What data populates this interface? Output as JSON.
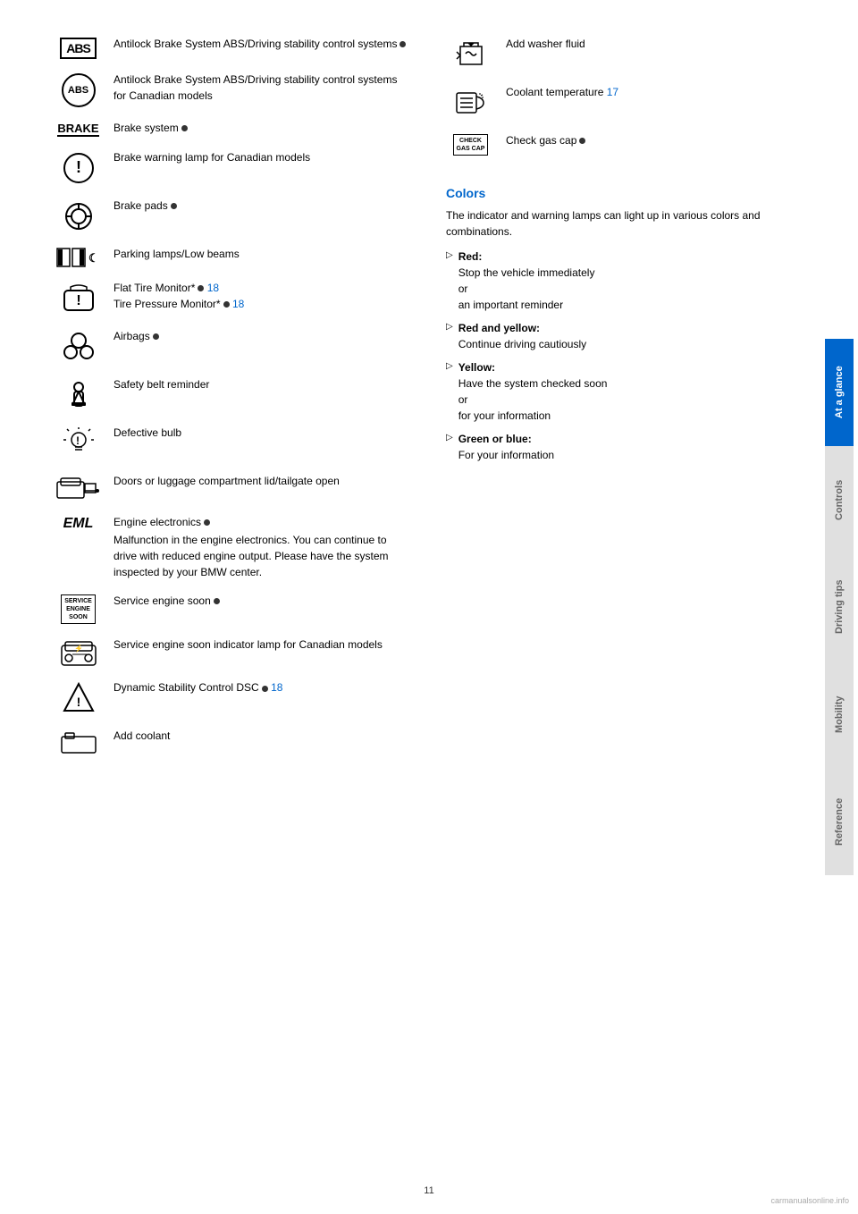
{
  "page": {
    "number": "11",
    "watermark": "carmanualsonline.info"
  },
  "sidebar": {
    "tabs": [
      {
        "id": "at-a-glance",
        "label": "At a glance",
        "active": true
      },
      {
        "id": "controls",
        "label": "Controls",
        "active": false
      },
      {
        "id": "driving-tips",
        "label": "Driving tips",
        "active": false
      },
      {
        "id": "mobility",
        "label": "Mobility",
        "active": false
      },
      {
        "id": "reference",
        "label": "Reference",
        "active": false
      }
    ]
  },
  "left_column": {
    "items": [
      {
        "id": "abs",
        "icon_type": "abs-text",
        "icon_text": "ABS",
        "text": "Antilock Brake System ABS/Driving stability control systems",
        "has_dot": true
      },
      {
        "id": "abs-canadian",
        "icon_type": "abs-circle",
        "icon_text": "ABS",
        "text": "Antilock Brake System ABS/Driving stability control systems for Canadian models",
        "has_dot": false
      },
      {
        "id": "brake",
        "icon_type": "brake-text",
        "icon_text": "BRAKE",
        "text": "Brake system",
        "has_dot": true
      },
      {
        "id": "brake-warning",
        "icon_type": "brake-warning-svg",
        "text": "Brake warning lamp for Canadian models",
        "has_dot": false
      },
      {
        "id": "brake-pads",
        "icon_type": "brake-pads-svg",
        "text": "Brake pads",
        "has_dot": true
      },
      {
        "id": "parking",
        "icon_type": "parking-svg",
        "text": "Parking lamps/Low beams",
        "has_dot": false
      },
      {
        "id": "flat-tire",
        "icon_type": "flat-tire-svg",
        "text": "Flat Tire Monitor* ",
        "text2": "Tire Pressure Monitor*",
        "has_link": true,
        "link": "18",
        "has_dot": true,
        "has_dot2": true,
        "link2": "18"
      },
      {
        "id": "airbags",
        "icon_type": "airbags-svg",
        "text": "Airbags",
        "has_dot": true
      },
      {
        "id": "seatbelt",
        "icon_type": "seatbelt-svg",
        "text": "Safety belt reminder",
        "has_dot": false
      },
      {
        "id": "defective-bulb",
        "icon_type": "defective-bulb-svg",
        "text": "Defective bulb",
        "has_dot": false
      },
      {
        "id": "doors",
        "icon_type": "doors-svg",
        "text": "Doors or luggage compartment lid/tailgate open",
        "has_dot": false
      },
      {
        "id": "eml",
        "icon_type": "eml-text",
        "icon_text": "EML",
        "text": "Engine electronics",
        "text2": "Malfunction in the engine electronics. You can continue to drive with reduced engine output. Please have the system inspected by your BMW center.",
        "has_dot": true
      },
      {
        "id": "service-engine",
        "icon_type": "service-text",
        "icon_text": "SERVICE\nENGINE\nSOON",
        "text": "Service engine soon",
        "has_dot": true
      },
      {
        "id": "service-engine-canadian",
        "icon_type": "service-canadian-svg",
        "text": "Service engine soon indicator lamp for Canadian models",
        "has_dot": false
      },
      {
        "id": "dsc",
        "icon_type": "dsc-svg",
        "text": "Dynamic Stability Control DSC",
        "has_dot": true,
        "has_link": true,
        "link": "18"
      },
      {
        "id": "add-coolant",
        "icon_type": "coolant-svg",
        "text": "Add coolant",
        "has_dot": false
      }
    ]
  },
  "right_column": {
    "items": [
      {
        "id": "washer-fluid",
        "icon_type": "washer-svg",
        "text": "Add washer fluid",
        "has_dot": false
      },
      {
        "id": "coolant-temp",
        "icon_type": "coolant-temp-svg",
        "text": "Coolant temperature",
        "has_link": true,
        "link": "17"
      },
      {
        "id": "check-gas-cap",
        "icon_type": "check-gas-svg",
        "icon_text": "CHECK\nGAS CAP",
        "text": "Check gas cap",
        "has_dot": true
      }
    ],
    "colors": {
      "title": "Colors",
      "intro": "The indicator and warning lamps can light up in various colors and combinations.",
      "items": [
        {
          "label": "Red:",
          "lines": [
            "Stop the vehicle immediately",
            "or",
            "an important reminder"
          ]
        },
        {
          "label": "Red and yellow:",
          "lines": [
            "Continue driving cautiously"
          ]
        },
        {
          "label": "Yellow:",
          "lines": [
            "Have the system checked soon",
            "or",
            "for your information"
          ]
        },
        {
          "label": "Green or blue:",
          "lines": [
            "For your information"
          ]
        }
      ]
    }
  }
}
